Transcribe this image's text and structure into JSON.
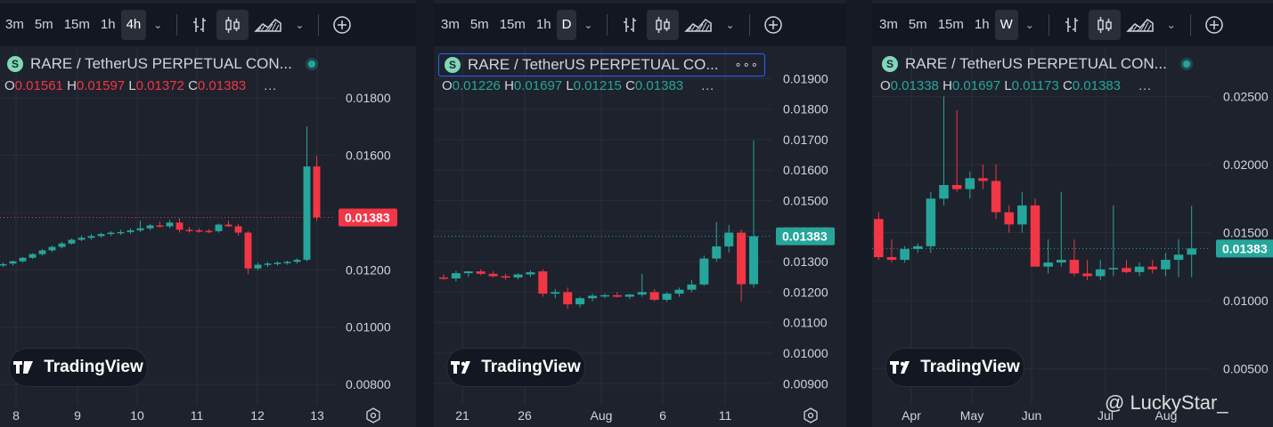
{
  "toolbar": {
    "timeframes_common": [
      "3m",
      "5m",
      "15m",
      "1h"
    ],
    "active_timeframes": [
      "4h",
      "D",
      "W"
    ]
  },
  "symbol": {
    "name": "RARE / TetherUS PERPETUAL CON...",
    "name_short": "RARE / TetherUS PERPETUAL CO...",
    "coin_glyph": "S",
    "more": "...",
    "options": "∘∘∘"
  },
  "brand": "TradingView",
  "watermark": "@ LuckyStar_",
  "colors": {
    "up": "#26a69a",
    "down": "#f23645",
    "bg": "#1e222d",
    "grid": "#2a2e39"
  },
  "panels": [
    {
      "timeframe": "4h",
      "ohlc": {
        "O": "0.01561",
        "H": "0.01597",
        "L": "0.01372",
        "C": "0.01383"
      },
      "ohlc_color": "red",
      "price_label": "0.01383"
    },
    {
      "timeframe": "D",
      "ohlc": {
        "O": "0.01226",
        "H": "0.01697",
        "L": "0.01215",
        "C": "0.01383"
      },
      "ohlc_color": "green",
      "price_label": "0.01383"
    },
    {
      "timeframe": "W",
      "ohlc": {
        "O": "0.01338",
        "H": "0.01697",
        "L": "0.01173",
        "C": "0.01383"
      },
      "ohlc_color": "green",
      "price_label": "0.01383"
    }
  ],
  "chart_data": [
    {
      "type": "candlestick",
      "timeframe": "4h",
      "x_ticks": [
        "8",
        "9",
        "10",
        "11",
        "12",
        "13"
      ],
      "y_ticks": [
        "0.00800",
        "0.01000",
        "0.01200",
        "0.01400",
        "0.01600",
        "0.01800"
      ],
      "ylim": [
        0.0076,
        0.019
      ],
      "last_price": 0.01383,
      "ohlc": [
        [
          0.0122,
          0.01225,
          0.0121,
          0.0122
        ],
        [
          0.01222,
          0.01232,
          0.01215,
          0.0123
        ],
        [
          0.0123,
          0.01245,
          0.01225,
          0.01242
        ],
        [
          0.01242,
          0.01258,
          0.01238,
          0.01255
        ],
        [
          0.01255,
          0.01272,
          0.0125,
          0.01268
        ],
        [
          0.01268,
          0.01285,
          0.01262,
          0.0128
        ],
        [
          0.0128,
          0.01298,
          0.01275,
          0.01292
        ],
        [
          0.01292,
          0.0131,
          0.01288,
          0.01305
        ],
        [
          0.01305,
          0.0132,
          0.013,
          0.01312
        ],
        [
          0.01312,
          0.01325,
          0.01305,
          0.01318
        ],
        [
          0.01318,
          0.0133,
          0.01312,
          0.01325
        ],
        [
          0.01325,
          0.01335,
          0.01318,
          0.0133
        ],
        [
          0.0133,
          0.0134,
          0.01322,
          0.01332
        ],
        [
          0.01332,
          0.01345,
          0.01325,
          0.01338
        ],
        [
          0.01338,
          0.01372,
          0.01332,
          0.01345
        ],
        [
          0.01345,
          0.0136,
          0.01338,
          0.01355
        ],
        [
          0.01355,
          0.01368,
          0.01348,
          0.01352
        ],
        [
          0.01352,
          0.01375,
          0.01345,
          0.01365
        ],
        [
          0.01365,
          0.0138,
          0.0133,
          0.0134
        ],
        [
          0.0134,
          0.0135,
          0.0133,
          0.01338
        ],
        [
          0.01338,
          0.01345,
          0.0133,
          0.01336
        ],
        [
          0.01336,
          0.01342,
          0.01328,
          0.01335
        ],
        [
          0.01335,
          0.01362,
          0.0133,
          0.01358
        ],
        [
          0.01358,
          0.01372,
          0.0135,
          0.01352
        ],
        [
          0.01352,
          0.0136,
          0.0132,
          0.0133
        ],
        [
          0.0133,
          0.01335,
          0.01185,
          0.01205
        ],
        [
          0.01205,
          0.01225,
          0.01198,
          0.01218
        ],
        [
          0.01218,
          0.01228,
          0.0121,
          0.01222
        ],
        [
          0.01222,
          0.0123,
          0.01215,
          0.01225
        ],
        [
          0.01225,
          0.01232,
          0.01218,
          0.01228
        ],
        [
          0.01228,
          0.0124,
          0.01222,
          0.01235
        ],
        [
          0.01235,
          0.017,
          0.0123,
          0.01561
        ],
        [
          0.01561,
          0.01597,
          0.01372,
          0.01383
        ]
      ]
    },
    {
      "type": "candlestick",
      "timeframe": "D",
      "x_ticks": [
        "21",
        "26",
        "Aug",
        "6",
        "11"
      ],
      "y_ticks": [
        "0.00900",
        "0.01000",
        "0.01100",
        "0.01200",
        "0.01300",
        "0.01400",
        "0.01500",
        "0.01600",
        "0.01700",
        "0.01800",
        "0.01900"
      ],
      "ylim": [
        0.0086,
        0.0193
      ],
      "last_price": 0.01383,
      "ohlc": [
        [
          0.01248,
          0.01258,
          0.0124,
          0.01245
        ],
        [
          0.01245,
          0.0127,
          0.01235,
          0.01262
        ],
        [
          0.01262,
          0.0127,
          0.0125,
          0.01268
        ],
        [
          0.01268,
          0.01275,
          0.01255,
          0.0126
        ],
        [
          0.0126,
          0.01268,
          0.01248,
          0.01252
        ],
        [
          0.01252,
          0.0126,
          0.0124,
          0.01248
        ],
        [
          0.01248,
          0.01262,
          0.01242,
          0.01258
        ],
        [
          0.01258,
          0.01272,
          0.0125,
          0.01265
        ],
        [
          0.01268,
          0.01275,
          0.01185,
          0.01195
        ],
        [
          0.01195,
          0.0121,
          0.0118,
          0.012
        ],
        [
          0.012,
          0.01215,
          0.01145,
          0.0116
        ],
        [
          0.0116,
          0.01185,
          0.0115,
          0.0118
        ],
        [
          0.0118,
          0.01195,
          0.0117,
          0.01188
        ],
        [
          0.01188,
          0.01195,
          0.0118,
          0.0119
        ],
        [
          0.0119,
          0.012,
          0.01182,
          0.01185
        ],
        [
          0.01185,
          0.01195,
          0.01178,
          0.01192
        ],
        [
          0.01192,
          0.0126,
          0.01185,
          0.012
        ],
        [
          0.012,
          0.0121,
          0.0117,
          0.01175
        ],
        [
          0.01175,
          0.012,
          0.01168,
          0.01195
        ],
        [
          0.01195,
          0.01215,
          0.01185,
          0.01208
        ],
        [
          0.01208,
          0.0124,
          0.012,
          0.01225
        ],
        [
          0.01225,
          0.0132,
          0.0122,
          0.0131
        ],
        [
          0.0131,
          0.0143,
          0.013,
          0.0135
        ],
        [
          0.0135,
          0.0142,
          0.0133,
          0.01395
        ],
        [
          0.01395,
          0.01405,
          0.0117,
          0.01226
        ],
        [
          0.01226,
          0.01697,
          0.01215,
          0.01383
        ]
      ]
    },
    {
      "type": "candlestick",
      "timeframe": "W",
      "x_ticks": [
        "Apr",
        "May",
        "Jun",
        "Jul",
        "Aug"
      ],
      "y_ticks": [
        "0.00500",
        "0.01000",
        "0.01500",
        "0.02000",
        "0.02500"
      ],
      "ylim": [
        0.003,
        0.027
      ],
      "last_price": 0.01383,
      "ohlc": [
        [
          0.016,
          0.0165,
          0.013,
          0.0132
        ],
        [
          0.0132,
          0.0145,
          0.0128,
          0.013
        ],
        [
          0.013,
          0.014,
          0.0128,
          0.0138
        ],
        [
          0.0138,
          0.0142,
          0.0135,
          0.014
        ],
        [
          0.014,
          0.018,
          0.0135,
          0.0175
        ],
        [
          0.0175,
          0.025,
          0.017,
          0.0185
        ],
        [
          0.0185,
          0.024,
          0.018,
          0.0182
        ],
        [
          0.0182,
          0.0195,
          0.0175,
          0.019
        ],
        [
          0.019,
          0.02,
          0.0182,
          0.0188
        ],
        [
          0.0188,
          0.02,
          0.016,
          0.0165
        ],
        [
          0.0165,
          0.017,
          0.015,
          0.0156
        ],
        [
          0.0156,
          0.018,
          0.015,
          0.017
        ],
        [
          0.017,
          0.0175,
          0.0125,
          0.0125
        ],
        [
          0.0125,
          0.0145,
          0.012,
          0.0128
        ],
        [
          0.0128,
          0.018,
          0.0125,
          0.013
        ],
        [
          0.013,
          0.0145,
          0.0118,
          0.012
        ],
        [
          0.012,
          0.013,
          0.0115,
          0.0118
        ],
        [
          0.0118,
          0.013,
          0.0115,
          0.0123
        ],
        [
          0.0123,
          0.017,
          0.0118,
          0.0124
        ],
        [
          0.0124,
          0.013,
          0.012,
          0.0121
        ],
        [
          0.0121,
          0.0128,
          0.0118,
          0.0125
        ],
        [
          0.0125,
          0.013,
          0.012,
          0.0123
        ],
        [
          0.0123,
          0.0135,
          0.0118,
          0.013
        ],
        [
          0.013,
          0.0145,
          0.01173,
          0.01338
        ],
        [
          0.01338,
          0.01697,
          0.01173,
          0.01383
        ]
      ]
    }
  ]
}
